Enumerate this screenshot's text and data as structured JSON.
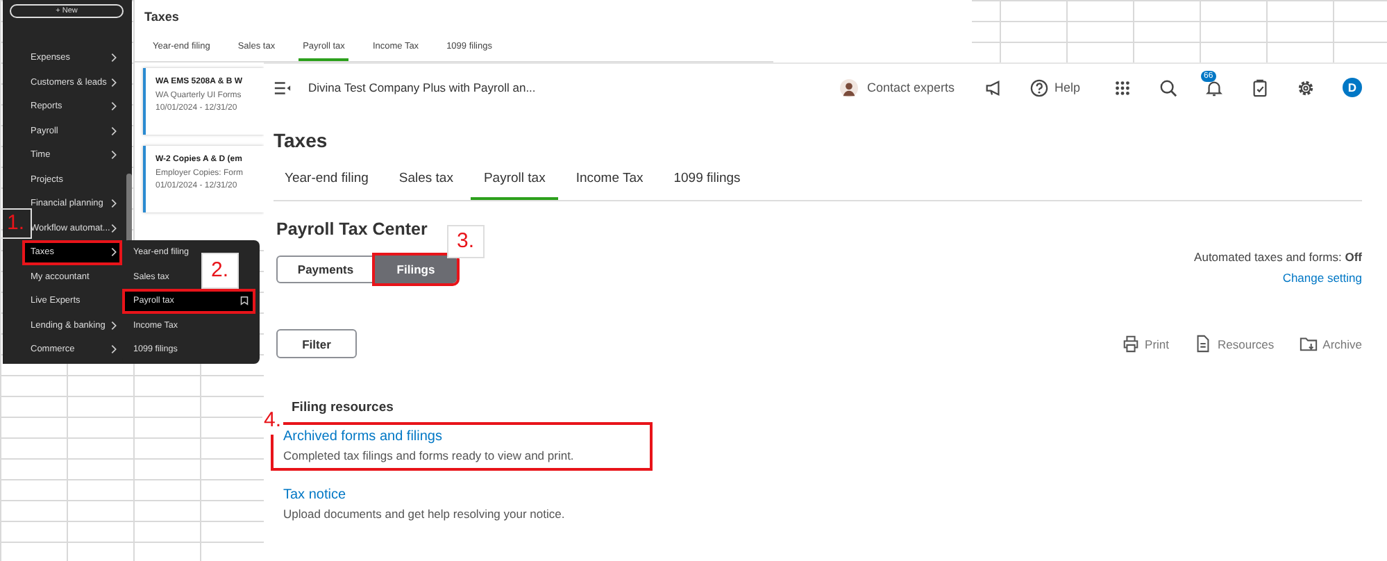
{
  "left_nav": {
    "new_button": "+ New",
    "items": [
      {
        "label": "Expenses",
        "expandable": true,
        "selected": false,
        "highlighted": false
      },
      {
        "label": "Customers & leads",
        "expandable": true,
        "selected": false,
        "highlighted": false
      },
      {
        "label": "Reports",
        "expandable": true,
        "selected": false,
        "highlighted": false
      },
      {
        "label": "Payroll",
        "expandable": true,
        "selected": false,
        "highlighted": false
      },
      {
        "label": "Time",
        "expandable": true,
        "selected": false,
        "highlighted": false
      },
      {
        "label": "Projects",
        "expandable": false,
        "selected": false,
        "highlighted": false
      },
      {
        "label": "Financial planning",
        "expandable": true,
        "selected": false,
        "highlighted": false
      },
      {
        "label": "Workflow automat...",
        "expandable": true,
        "selected": false,
        "highlighted": false
      },
      {
        "label": "Taxes",
        "expandable": true,
        "selected": true,
        "highlighted": true
      },
      {
        "label": "My accountant",
        "expandable": false,
        "selected": false,
        "highlighted": false
      },
      {
        "label": "Live Experts",
        "expandable": false,
        "selected": false,
        "highlighted": false
      },
      {
        "label": "Lending & banking",
        "expandable": true,
        "selected": false,
        "highlighted": false
      },
      {
        "label": "Commerce",
        "expandable": true,
        "selected": false,
        "highlighted": false
      }
    ],
    "submenu": [
      {
        "label": "Year-end filing",
        "selected": false,
        "highlighted": false
      },
      {
        "label": "Sales tax",
        "selected": false,
        "highlighted": false
      },
      {
        "label": "Payroll tax",
        "selected": true,
        "highlighted": true
      },
      {
        "label": "Income Tax",
        "selected": false,
        "highlighted": false
      },
      {
        "label": "1099 filings",
        "selected": false,
        "highlighted": false
      }
    ]
  },
  "back_screen": {
    "title": "Taxes",
    "tabs": [
      {
        "label": "Year-end filing",
        "selected": false
      },
      {
        "label": "Sales tax",
        "selected": false
      },
      {
        "label": "Payroll tax",
        "selected": true
      },
      {
        "label": "Income Tax",
        "selected": false
      },
      {
        "label": "1099 filings",
        "selected": false
      }
    ],
    "cards": [
      {
        "title": "WA EMS 5208A & B W",
        "subtitle": "WA Quarterly UI Forms",
        "dates": "10/01/2024 - 12/31/20"
      },
      {
        "title": "W-2 Copies A & D (em",
        "subtitle": "Employer Copies: Form",
        "dates": "01/01/2024 - 12/31/20"
      }
    ]
  },
  "front_screen": {
    "company": "Divina Test Company Plus with Payroll an...",
    "toolbar": [
      {
        "kind": "contact",
        "label": "Contact experts"
      },
      {
        "kind": "announce"
      },
      {
        "kind": "help",
        "label": "Help"
      },
      {
        "kind": "apps"
      },
      {
        "kind": "search"
      },
      {
        "kind": "notifications",
        "badge": "66"
      },
      {
        "kind": "tasks"
      },
      {
        "kind": "settings"
      },
      {
        "kind": "profile",
        "label": "D"
      }
    ],
    "title": "Taxes",
    "tabs": [
      {
        "label": "Year-end filing",
        "selected": false
      },
      {
        "label": "Sales tax",
        "selected": false
      },
      {
        "label": "Payroll tax",
        "selected": true
      },
      {
        "label": "Income Tax",
        "selected": false
      },
      {
        "label": "1099 filings",
        "selected": false
      }
    ],
    "section_title": "Payroll Tax Center",
    "segments": [
      {
        "label": "Payments",
        "selected": false,
        "highlighted": false
      },
      {
        "label": "Filings",
        "selected": true,
        "highlighted": true
      }
    ],
    "automation": {
      "label": "Automated taxes and forms: **Off**",
      "link": "Change setting"
    },
    "filter_button": "Filter",
    "actions": [
      {
        "kind": "print",
        "label": "Print"
      },
      {
        "kind": "resources",
        "label": "Resources"
      },
      {
        "kind": "archive",
        "label": "Archive"
      }
    ],
    "resources_title": "Filing resources",
    "resources": [
      {
        "title": "Archived forms and filings",
        "description": "Completed tax filings and forms ready to view and print.",
        "highlighted": true
      },
      {
        "title": "Tax notice",
        "description": "Upload documents and get help resolving your notice.",
        "highlighted": false
      }
    ]
  },
  "annotations": [
    {
      "label": "1."
    },
    {
      "label": "2."
    },
    {
      "label": "3."
    },
    {
      "label": "4."
    }
  ]
}
